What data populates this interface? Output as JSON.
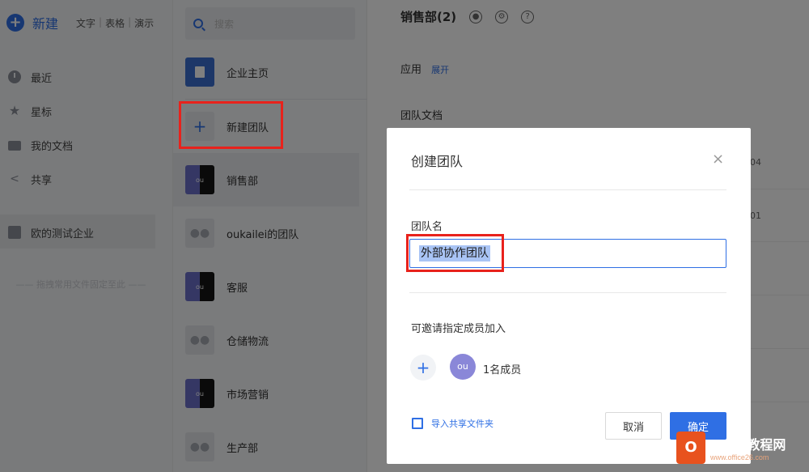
{
  "sidebar": {
    "new_label": "新建",
    "new_types": [
      "文字",
      "表格",
      "演示"
    ],
    "nav": [
      {
        "label": "最近",
        "icon": "clock-icon"
      },
      {
        "label": "星标",
        "icon": "star-icon"
      },
      {
        "label": "我的文档",
        "icon": "folder-icon"
      },
      {
        "label": "共享",
        "icon": "share-icon"
      }
    ],
    "corp": "欧的测试企业",
    "pin_hint": "拖拽常用文件固定至此"
  },
  "teams": {
    "search_placeholder": "搜索",
    "items": [
      {
        "label": "企业主页"
      },
      {
        "label": "新建团队"
      },
      {
        "label": "销售部"
      },
      {
        "label": "oukailei的团队"
      },
      {
        "label": "客服"
      },
      {
        "label": "仓储物流"
      },
      {
        "label": "市场营销"
      },
      {
        "label": "生产部"
      }
    ],
    "avatar_text": "ou"
  },
  "main": {
    "title": "销售部(2)",
    "apps_label": "应用",
    "apps_expand": "展开",
    "docs_label": "团队文档",
    "row_nums": [
      "04",
      "01"
    ]
  },
  "dialog": {
    "title": "创建团队",
    "close_glyph": "×",
    "name_label": "团队名",
    "name_value": "外部协作团队",
    "invite_label": "可邀请指定成员加入",
    "member_avatar": "ou",
    "member_count": "1名成员",
    "import_label": "导入共享文件夹",
    "cancel_label": "取消",
    "ok_label": "确定"
  },
  "watermark": {
    "brand": "Office教程网",
    "url": "www.office26.com"
  }
}
